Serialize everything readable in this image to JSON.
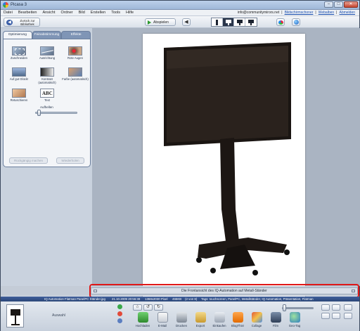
{
  "window": {
    "title": "Picasa 3",
    "minimize": "–",
    "maximize": "□",
    "close": "✕"
  },
  "menu": [
    "Datei",
    "Bearbeiten",
    "Ansicht",
    "Ordner",
    "Bild",
    "Erstellen",
    "Tools",
    "Hilfe"
  ],
  "account": {
    "email": "info@communitymirors.net",
    "sep1": "|",
    "link1": "Bildschirmschoner",
    "sep2": "|",
    "link2": "Webalben",
    "sep3": "|",
    "link3": "Abmelden"
  },
  "toolbar": {
    "back_label": "Zurück zur Bibliothek",
    "play_label": "Abspielen",
    "prev": "◀",
    "next": "▶"
  },
  "edit_tabs": [
    "Optimierung",
    "Feinabstimmung",
    "Effekte"
  ],
  "tools": [
    {
      "label": "Zuschneiden",
      "icon": "crop-icon"
    },
    {
      "label": "Ausrichtung",
      "icon": "straighten-icon"
    },
    {
      "label": "Rote Augen",
      "icon": "redeye-icon"
    },
    {
      "label": "Auf gut Glück!",
      "icon": "lucky-icon"
    },
    {
      "label": "Kontrast (automatisch)",
      "icon": "contrast-icon"
    },
    {
      "label": "Farbe (automatisch)",
      "icon": "color-icon"
    },
    {
      "label": "Retuschieren",
      "icon": "retouch-icon"
    },
    {
      "label": "Text",
      "icon": "text-icon",
      "glyph": "ABC"
    }
  ],
  "fill_light": {
    "label": "Aufhellen",
    "level": 0.05
  },
  "edit_buttons": {
    "undo": "Rückgängig machen",
    "redo": "Wiederholen"
  },
  "caption": "Die Frontansicht des IQ-Automation auf Metall-Ständer",
  "status": {
    "file": "IQ Automation Flatman PanelPC Ständer.jpg",
    "date": "21.10.2009 20:56:38",
    "dimensions": "1368x2030 Pixel",
    "size": "465KB",
    "position": "(2 von 8)",
    "tags": "Tags: touchscreen, PanelPC, Metallständer, IQ Automation, Präsentation, Flatman"
  },
  "tray": {
    "selection_label": "Auswahl",
    "tools": [
      "Hochladen",
      "E-Mail",
      "Drucken",
      "Export",
      "Einkaufen",
      "BlogThis!",
      "Collage",
      "Film",
      "Geo-Tag"
    ]
  },
  "colors": {
    "accent": "#3f5f9c",
    "highlight": "#e01818",
    "tray_bg": "#c7d0dc"
  }
}
